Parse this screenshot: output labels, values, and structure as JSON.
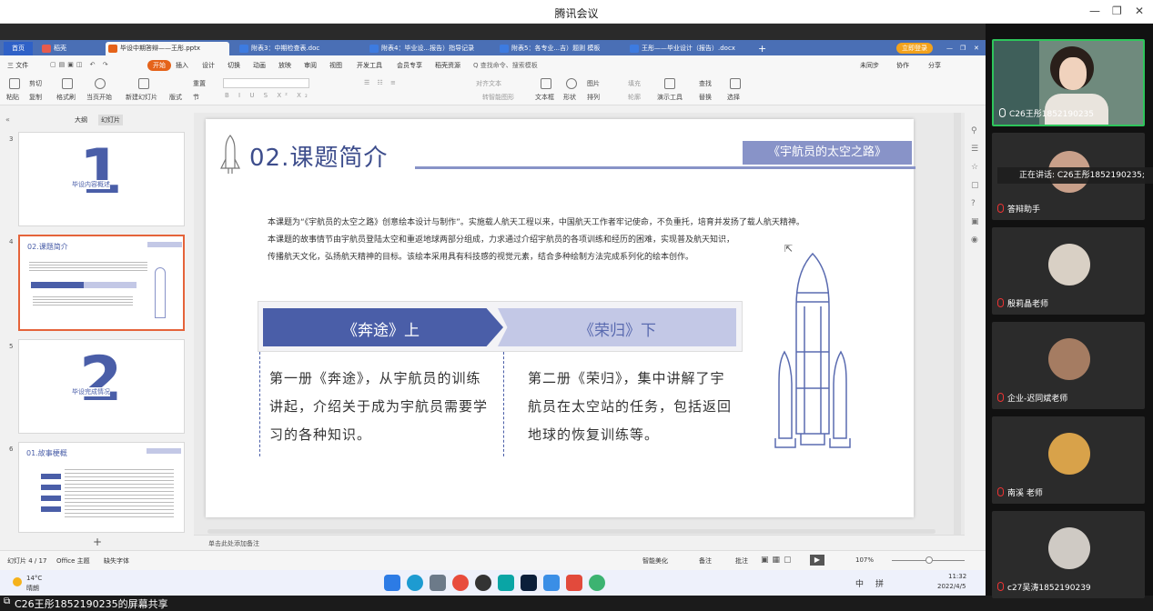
{
  "window": {
    "title": "腾讯会议"
  },
  "tabs": [
    {
      "label": "首页"
    },
    {
      "label": "稻壳"
    },
    {
      "label": "毕设中期答辩——王彤.pptx"
    },
    {
      "label": "附表3：中期检查表.doc"
    },
    {
      "label": "附表4：毕业设...报告）指导记录"
    },
    {
      "label": "附表5：各专业...吉）题则 模板"
    },
    {
      "label": "王彤——毕业设计（报告）.docx"
    }
  ],
  "account": {
    "login_label": "立即登录"
  },
  "menu": {
    "file": "三 文件",
    "items": [
      "开始",
      "插入",
      "设计",
      "切换",
      "动画",
      "放映",
      "审阅",
      "视图",
      "开发工具",
      "会员专享",
      "稻壳资源"
    ],
    "search": "Q 查找命令、搜索模板",
    "sync": "未同步",
    "collab": "协作",
    "share": "分享"
  },
  "ribbon": {
    "paste": "粘贴",
    "cut": "剪切",
    "copy": "复制",
    "format": "格式刷",
    "play": "当页开始",
    "new": "新建幻灯片",
    "layout": "版式",
    "section": "节",
    "reset": "重置",
    "textbox": "文本框",
    "shape": "形状",
    "arrange": "排列",
    "picture": "图片",
    "fill": "填充",
    "outline": "轮廓",
    "tools": "演示工具",
    "find": "查找",
    "replace": "替换",
    "select": "选择",
    "align_text": "对齐文本",
    "smartart": "转智能图形"
  },
  "leftpane": {
    "tab_outline": "大纲",
    "tab_slides": "幻灯片"
  },
  "thumbs": [
    {
      "num": "3",
      "big": "1",
      "caption": "毕设内容概述"
    },
    {
      "num": "4",
      "caption": "02.课题简介"
    },
    {
      "num": "5",
      "big": "2",
      "caption": "毕设完成情况"
    },
    {
      "num": "6",
      "caption": "01.故事梗概"
    }
  ],
  "slide": {
    "title": "02.课题简介",
    "badge": "《宇航员的太空之路》",
    "para1": "本课题为“《宇航员的太空之路》创意绘本设计与制作”。实施载人航天工程以来，中国航天工作者牢记使命，不负重托，培育并发扬了载人航天精神。",
    "para2": "本课题的故事情节由宇航员登陆太空和重返地球两部分组成，力求通过介绍宇航员的各项训练和经历的困难，实现普及航天知识，",
    "para3": "传播航天文化，弘扬航天精神的目标。该绘本采用具有科技感的视觉元素，结合多种绘制方法完成系列化的绘本创作。",
    "tab1": "《奔途》上",
    "tab2": "《荣归》下",
    "col1": [
      "第一册《奔途》，从宇航员的训练",
      "讲起，介绍关于成为宇航员需要学",
      "习的各种知识。"
    ],
    "col2": [
      "第二册《荣归》，集中讲解了宇",
      "航员在太空站的任务，包括返回",
      "地球的恢复训练等。"
    ]
  },
  "notes": {
    "placeholder": "单击此处添加备注"
  },
  "status": {
    "slide": "幻灯片 4 / 17",
    "theme": "Office 主题",
    "font": "缺失字体",
    "beautify": "智能美化",
    "notes": "备注",
    "comment": "批注",
    "zoom": "107%"
  },
  "taskbar": {
    "weather_temp": "14°C",
    "weather_text": "晴朗",
    "time": "11:32",
    "date": "2022/4/5",
    "ime1": "中",
    "ime2": "拼"
  },
  "share_notice": "C26王彤1852190235的屏幕共享",
  "participants": [
    {
      "name": "C26王彤1852190235"
    },
    {
      "name": "答辩助手",
      "speaking": "正在讲话: C26王彤1852190235;"
    },
    {
      "name": "殷莉晶老师"
    },
    {
      "name": "企业-迟同斌老师"
    },
    {
      "name": "南溪 老师"
    },
    {
      "name": "c27吴涛1852190239"
    }
  ],
  "colors": {
    "accent": "#4a5ea8",
    "tab_blue": "#4a6fb5",
    "wps_orange": "#e5631a",
    "speaker_green": "#2ec55b"
  }
}
